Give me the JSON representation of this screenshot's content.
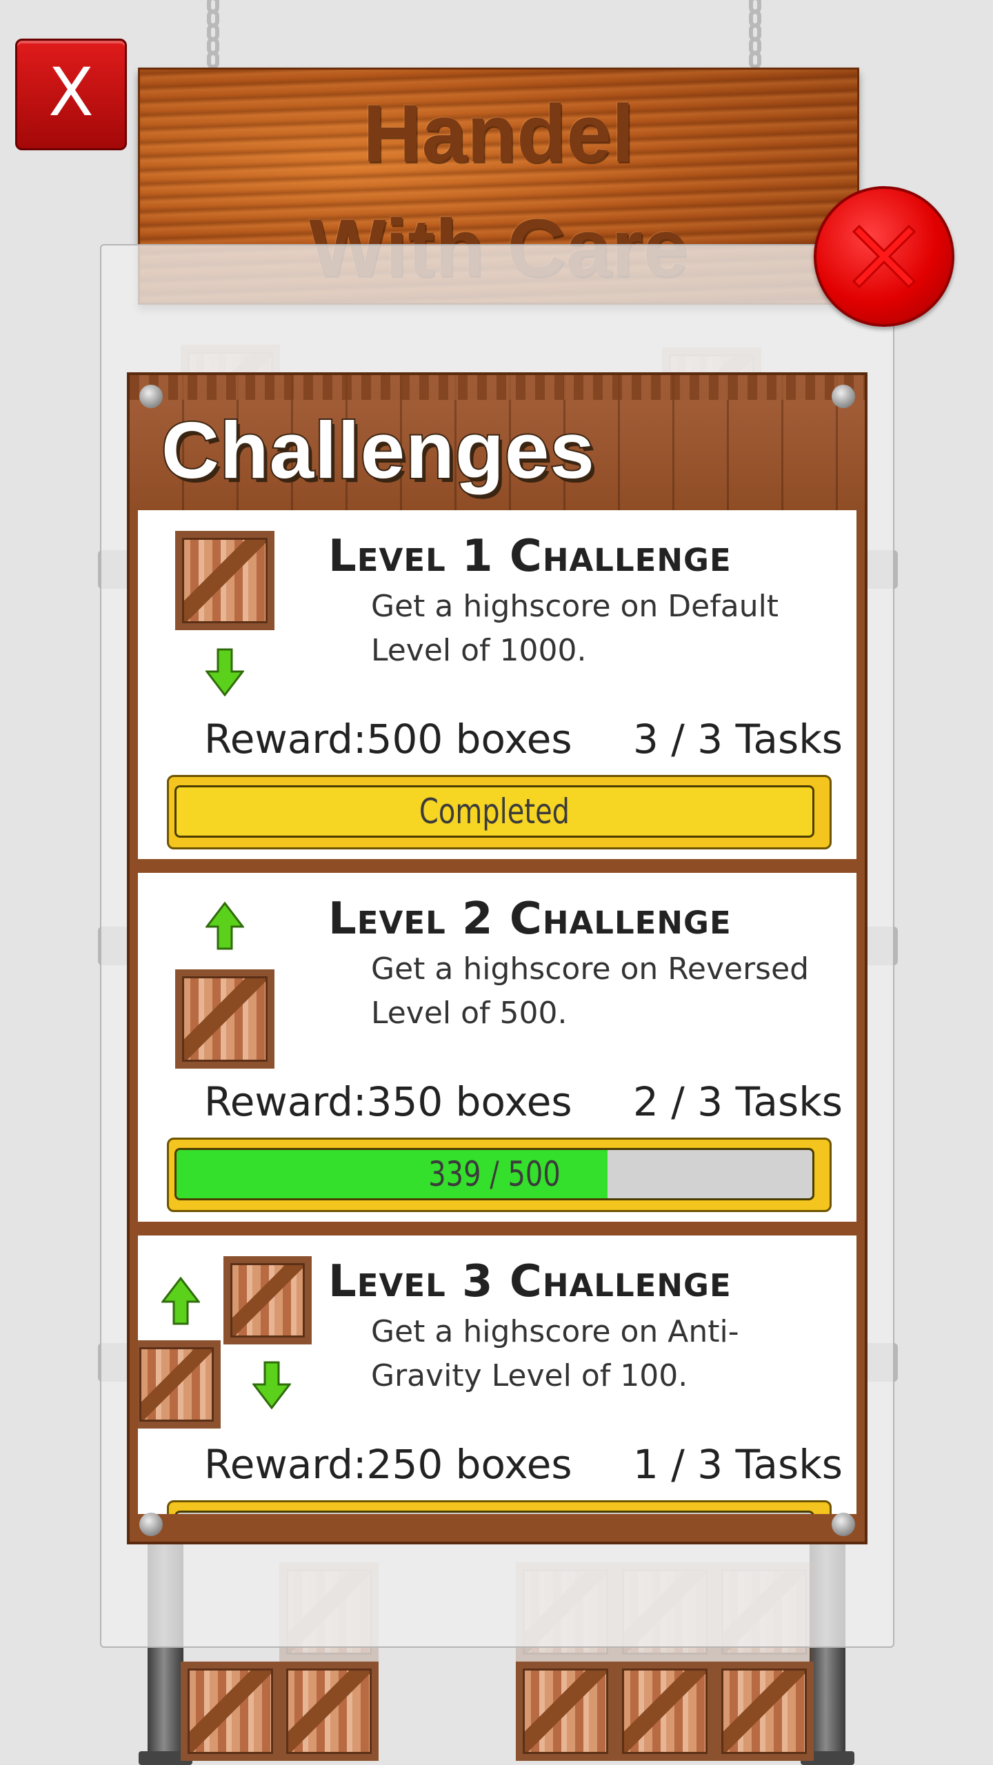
{
  "game": {
    "sign": {
      "line1": "Handel",
      "line2": "With Care"
    },
    "top_close_label": "X"
  },
  "panel": {
    "title": "Challenges",
    "challenges": [
      {
        "title": "Level 1 Challenge",
        "description": "Get a highscore on Default Level of 1000.",
        "reward": "Reward:500 boxes",
        "tasks": "3 / 3 Tasks",
        "progress_label": "Completed",
        "progress_fraction": 1.0,
        "status": "completed",
        "icon": "crate-falling-down"
      },
      {
        "title": "Level 2 Challenge",
        "description": "Get a highscore on Reversed Level of 500.",
        "reward": "Reward:350 boxes",
        "tasks": "2 / 3 Tasks",
        "progress_label": "339 / 500",
        "progress_fraction": 0.678,
        "status": "in-progress",
        "icon": "crate-rising-up"
      },
      {
        "title": "Level 3 Challenge",
        "description": "Get a highscore on Anti-Gravity Level of 100.",
        "reward": "Reward:250 boxes",
        "tasks": "1 / 3 Tasks",
        "progress_label": "",
        "progress_fraction": 0,
        "status": "in-progress",
        "icon": "crates-mixed-gravity"
      }
    ]
  },
  "colors": {
    "accent_red": "#e10000",
    "progress_green": "#34e02b",
    "progress_gold": "#f3c51e",
    "panel_wood": "#8f4d26"
  }
}
